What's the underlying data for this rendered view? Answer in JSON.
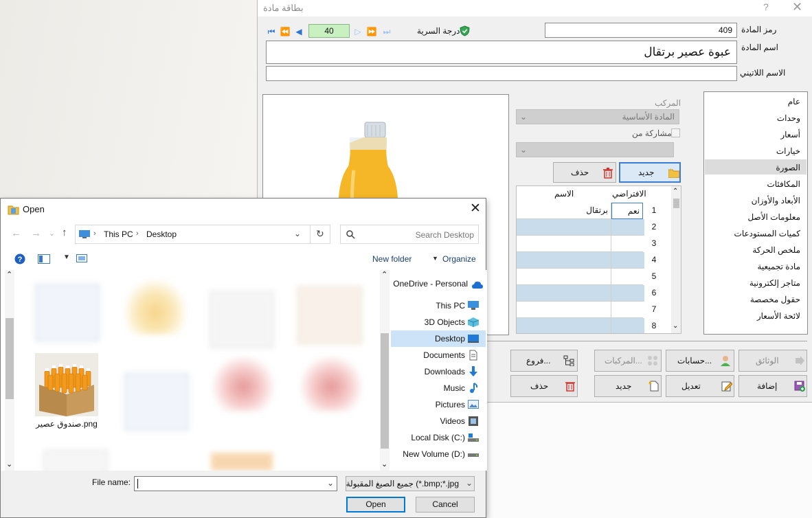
{
  "main_window": {
    "title": "بطاقة مادة",
    "help": "?",
    "close": "✕",
    "code_label": "رمز المادة",
    "code_value": "409",
    "name_label": "اسم المادة",
    "name_value": "عبوة عصير برتقال",
    "latin_label": "الاسم اللاتيني",
    "latin_value": "",
    "nav_value": "40",
    "secrecy_label": "درجة السرية",
    "composite_label": "المركب",
    "composite_value": "المادة الأساسية",
    "share_label": "مشاركة من",
    "new_label": "جديد",
    "delete_label": "حذف",
    "grid": {
      "col_default": "الافتراضي",
      "col_name": "الاسم",
      "rows": [
        {
          "num": "1",
          "name": "برتقال",
          "def": "نعم"
        },
        {
          "num": "2",
          "name": "",
          "def": ""
        },
        {
          "num": "3",
          "name": "",
          "def": ""
        },
        {
          "num": "4",
          "name": "",
          "def": ""
        },
        {
          "num": "5",
          "name": "",
          "def": ""
        },
        {
          "num": "6",
          "name": "",
          "def": ""
        },
        {
          "num": "7",
          "name": "",
          "def": ""
        },
        {
          "num": "8",
          "name": "",
          "def": ""
        }
      ]
    },
    "side_items": [
      "عام",
      "وحدات",
      "أسعار",
      "خيارات",
      "الصورة",
      "المكافئات",
      "الأبعاد والأوزان",
      "معلومات الأصل",
      "كميات المستودعات",
      "ملخص الحركة",
      "مادة تجميعية",
      "متاجر إلكترونية",
      "حقول مخصصة",
      "لائحة الأسعار"
    ],
    "bottom_buttons": {
      "docs": "الوثائق",
      "accounts": "حسابات...",
      "composites": "المركبات...",
      "branches": "فروع...",
      "add": "إضافة",
      "edit": "تعديل",
      "new": "جديد",
      "delete": "حذف"
    }
  },
  "open_dialog": {
    "title": "Open",
    "close": "✕",
    "breadcrumb": [
      "This PC",
      "Desktop"
    ],
    "search_placeholder": "Search Desktop",
    "new_folder": "New folder",
    "organize": "Organize",
    "file_label": "صندوق عصير.png",
    "nav_items": [
      {
        "label": "OneDrive - Personal",
        "icon": "cloud-icon"
      },
      {
        "label": "This PC",
        "icon": "computer-icon"
      },
      {
        "label": "3D Objects",
        "icon": "cube-icon"
      },
      {
        "label": "Desktop",
        "icon": "desktop-icon"
      },
      {
        "label": "Documents",
        "icon": "document-icon"
      },
      {
        "label": "Downloads",
        "icon": "download-icon"
      },
      {
        "label": "Music",
        "icon": "music-icon"
      },
      {
        "label": "Pictures",
        "icon": "picture-icon"
      },
      {
        "label": "Videos",
        "icon": "video-icon"
      },
      {
        "label": "Local Disk (C:)",
        "icon": "drive-icon"
      },
      {
        "label": "New Volume (D:)",
        "icon": "drive-icon"
      }
    ],
    "file_name_label": "File name:",
    "file_name_value": "",
    "filter_value": "جميع الصيغ المقبولة (*.bmp;*.jpg",
    "open_button": "Open",
    "cancel_button": "Cancel"
  }
}
